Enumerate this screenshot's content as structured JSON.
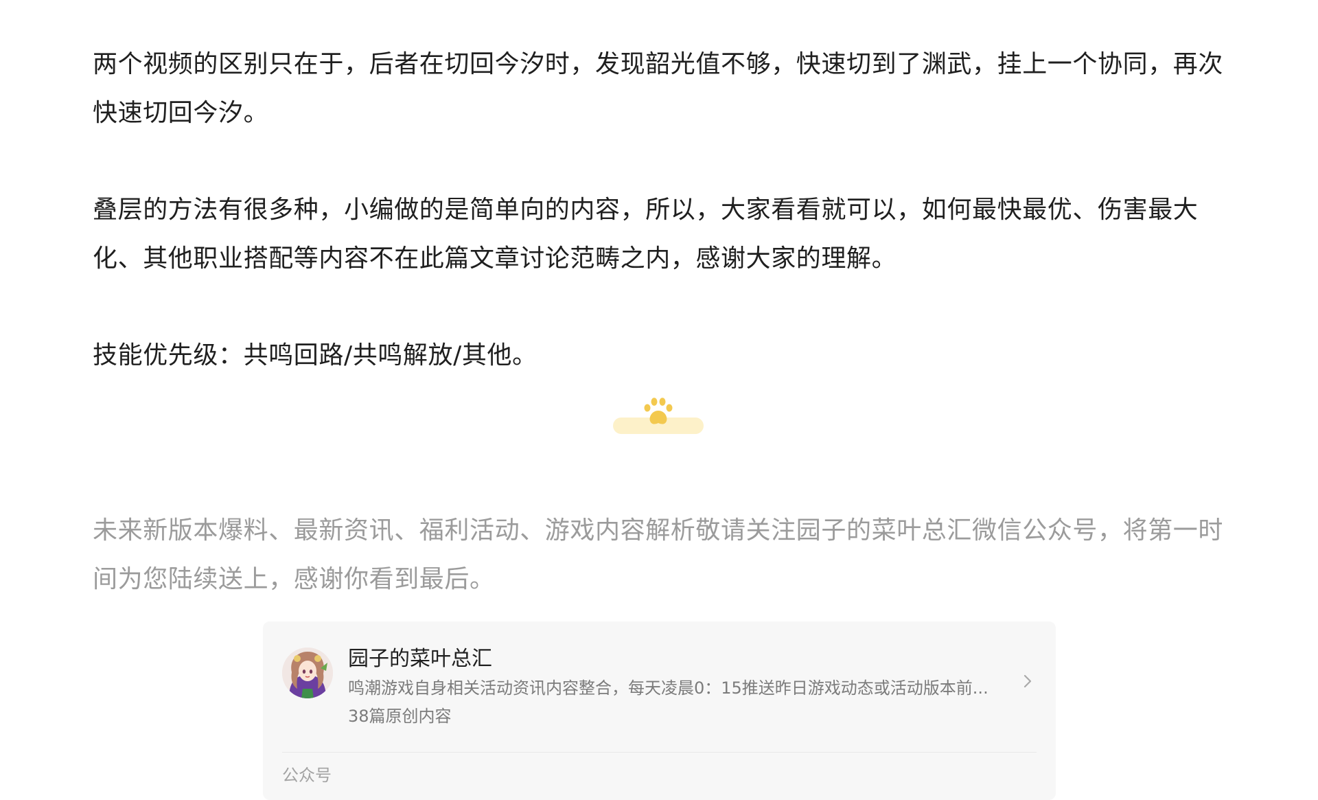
{
  "article": {
    "paragraphs": [
      "两个视频的区别只在于，后者在切回今汐时，发现韶光值不够，快速切到了渊武，挂上一个协同，再次快速切回今汐。",
      "叠层的方法有很多种，小编做的是简单向的内容，所以，大家看看就可以，如何最快最优、伤害最大化、其他职业搭配等内容不在此篇文章讨论范畴之内，感谢大家的理解。",
      "技能优先级：共鸣回路/共鸣解放/其他。"
    ]
  },
  "divider": {
    "icon": "paw-icon",
    "bar_color": "#fdf1c9",
    "paw_color": "#f3c94f"
  },
  "footer_note": {
    "text": "未来新版本爆料、最新资讯、福利活动、游戏内容解析敬请关注园子的菜叶总汇微信公众号，将第一时间为您陆续送上，感谢你看到最后。"
  },
  "profile_card": {
    "name": "园子的菜叶总汇",
    "description": "鸣潮游戏自身相关活动资讯内容整合，每天凌晨0：15推送昨日游戏动态或活动版本前...",
    "count": "38篇原创内容",
    "footer_label": "公众号",
    "avatar": "avatar-anime-girl",
    "chevron": "chevron-right-icon"
  }
}
